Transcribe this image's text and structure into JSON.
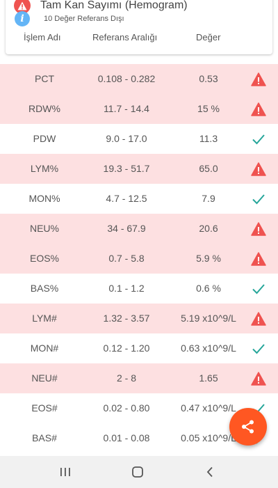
{
  "header": {
    "title": "Tam Kan Sayımı (Hemogram)",
    "subtitle": "10 Değer Referans Dışı",
    "warning_icon": "warning-icon",
    "info_icon": "info-icon",
    "info_glyph": "i"
  },
  "columns": {
    "name": "İşlem Adı",
    "range": "Referans Aralığı",
    "value": "Değer"
  },
  "colors": {
    "abnormal_row": "#fde0e1",
    "warning": "#ef5350",
    "ok_check": "#26a69a",
    "fab": "#ff5722",
    "info": "#64b5f6"
  },
  "rows": [
    {
      "name": "PCT",
      "range": "0.108 - 0.282",
      "value": "0.53",
      "status": "warning"
    },
    {
      "name": "RDW%",
      "range": "11.7 - 14.4",
      "value": "15 %",
      "status": "warning"
    },
    {
      "name": "PDW",
      "range": "9.0 - 17.0",
      "value": "11.3",
      "status": "ok"
    },
    {
      "name": "LYM%",
      "range": "19.3 - 51.7",
      "value": "65.0",
      "status": "warning"
    },
    {
      "name": "MON%",
      "range": "4.7 - 12.5",
      "value": "7.9",
      "status": "ok"
    },
    {
      "name": "NEU%",
      "range": "34 - 67.9",
      "value": "20.6",
      "status": "warning"
    },
    {
      "name": "EOS%",
      "range": "0.7 - 5.8",
      "value": "5.9 %",
      "status": "warning"
    },
    {
      "name": "BAS%",
      "range": "0.1 - 1.2",
      "value": "0.6 %",
      "status": "ok"
    },
    {
      "name": "LYM#",
      "range": "1.32 - 3.57",
      "value": "5.19 x10^9/L",
      "status": "warning"
    },
    {
      "name": "MON#",
      "range": "0.12 - 1.20",
      "value": "0.63 x10^9/L",
      "status": "ok"
    },
    {
      "name": "NEU#",
      "range": "2 - 8",
      "value": "1.65",
      "status": "warning"
    },
    {
      "name": "EOS#",
      "range": "0.02 - 0.80",
      "value": "0.47 x10^9/L",
      "status": "ok"
    },
    {
      "name": "BAS#",
      "range": "0.01 - 0.08",
      "value": "0.05 x10^9/L",
      "status": "ok"
    }
  ],
  "fab": {
    "icon": "share-icon"
  },
  "navbar": {
    "recents_icon": "recents-icon",
    "home_icon": "home-icon",
    "back_icon": "back-icon"
  }
}
